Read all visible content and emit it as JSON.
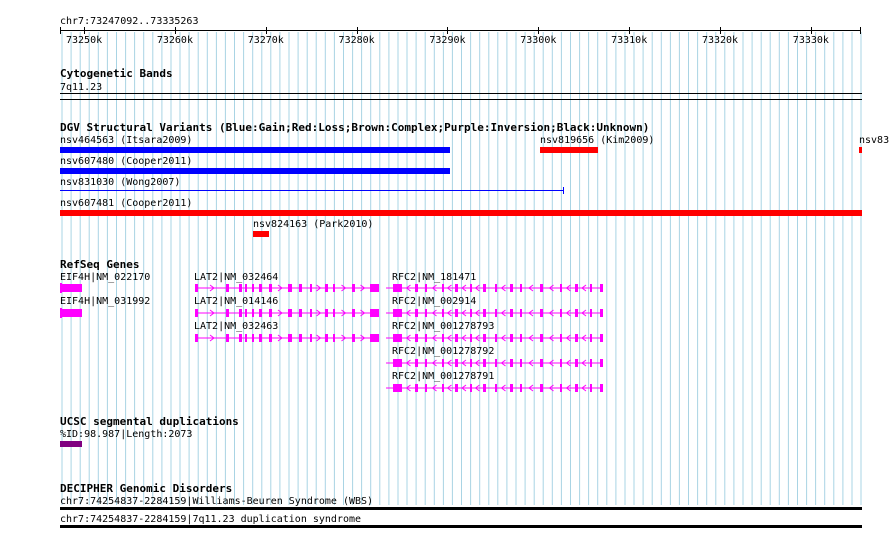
{
  "ruler": {
    "range": "chr7:73247092..73335263",
    "ticks": [
      "73250k",
      "73260k",
      "73270k",
      "73280k",
      "73290k",
      "73300k",
      "73310k",
      "73320k",
      "73330k"
    ]
  },
  "cytobands": {
    "title": "Cytogenetic Bands",
    "band": "7q11.23"
  },
  "dgv": {
    "title": "DGV Structural Variants (Blue:Gain;Red:Loss;Brown:Complex;Purple:Inversion;Black:Unknown)",
    "variants": [
      {
        "label": "nsv464563 (Itsara2009)",
        "color": "#0000ff"
      },
      {
        "label": "nsv819656 (Kim2009)",
        "color": "#ff0000"
      },
      {
        "label": "nsv83",
        "color": "#ff0000"
      },
      {
        "label": "nsv607480 (Cooper2011)",
        "color": "#0000ff"
      },
      {
        "label": "nsv831030 (Wong2007)",
        "color": "#0000ff"
      },
      {
        "label": "nsv607481 (Cooper2011)",
        "color": "#ff0000"
      },
      {
        "label": "nsv824163 (Park2010)",
        "color": "#ff0000"
      }
    ]
  },
  "refseq": {
    "title": "RefSeq Genes",
    "color": "#ff00ff",
    "genes": [
      {
        "label": "EIF4H|NM_022170"
      },
      {
        "label": "EIF4H|NM_031992"
      },
      {
        "label": "LAT2|NM_032464"
      },
      {
        "label": "LAT2|NM_014146"
      },
      {
        "label": "LAT2|NM_032463"
      },
      {
        "label": "RFC2|NM_181471"
      },
      {
        "label": "RFC2|NM_002914"
      },
      {
        "label": "RFC2|NM_001278793"
      },
      {
        "label": "RFC2|NM_001278792"
      },
      {
        "label": "RFC2|NM_001278791"
      }
    ]
  },
  "segdups": {
    "title": "UCSC segmental duplications",
    "label": "%ID:98.987|Length:2073",
    "color": "#800080"
  },
  "decipher": {
    "title": "DECIPHER Genomic Disorders",
    "items": [
      {
        "label": "chr7:74254837-2284159|Williams-Beuren Syndrome (WBS)"
      },
      {
        "label": "chr7:74254837-2284159|7q11.23 duplication syndrome"
      }
    ]
  },
  "colors": {
    "grid": "#a9d4e4",
    "gain": "#0000ff",
    "loss": "#ff0000",
    "gene": "#ff00ff",
    "segdup": "#800080"
  }
}
